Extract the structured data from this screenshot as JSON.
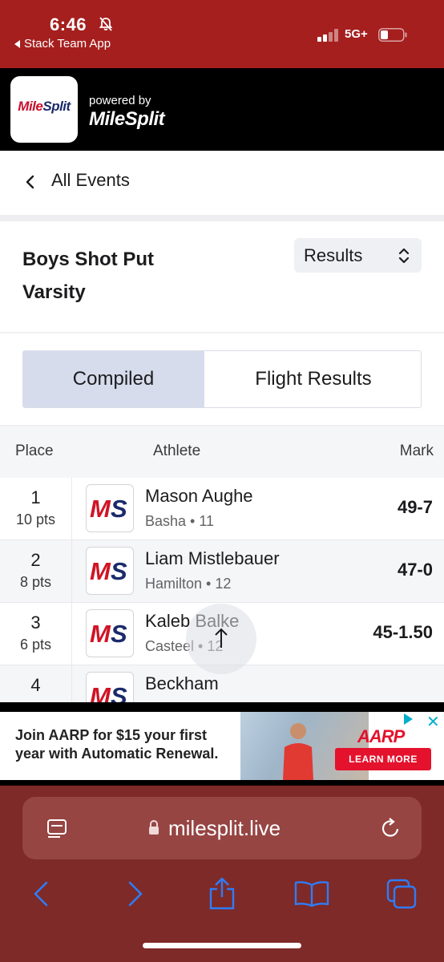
{
  "status_bar": {
    "time": "6:46",
    "back_app": "Stack Team App",
    "network": "5G+",
    "colors": {
      "background": "#a51f1e"
    }
  },
  "header": {
    "logo_text_mile": "Mile",
    "logo_text_split": "Split",
    "powered_by": "powered by",
    "brand": "MileSplit"
  },
  "nav": {
    "back_label": "All Events"
  },
  "event": {
    "title_line1": "Boys Shot Put",
    "title_line2": "Varsity",
    "view_select": "Results"
  },
  "tabs": [
    {
      "label": "Compiled",
      "active": true
    },
    {
      "label": "Flight Results",
      "active": false
    }
  ],
  "table": {
    "columns": {
      "place": "Place",
      "athlete": "Athlete",
      "mark": "Mark"
    },
    "rows": [
      {
        "place": "1",
        "points": "10 pts",
        "name": "Mason Aughe",
        "meta": "Basha • 11",
        "mark": "49-7"
      },
      {
        "place": "2",
        "points": "8 pts",
        "name": "Liam Mistlebauer",
        "meta": "Hamilton • 12",
        "mark": "47-0"
      },
      {
        "place": "3",
        "points": "6 pts",
        "name": "Kaleb Balke",
        "meta": "Casteel • 12",
        "mark": "45-1.50"
      },
      {
        "place": "4",
        "points": "",
        "name": "Beckham",
        "meta": "",
        "mark": ""
      }
    ],
    "badge_m": "M",
    "badge_s": "S"
  },
  "ad": {
    "text": "Join AARP for $15 your first year with Automatic Renewal.",
    "logo": "AARP",
    "cta": "LEARN MORE"
  },
  "browser": {
    "url": "milesplit.live",
    "colors": {
      "toolbar": "#7e2a28",
      "accent": "#2f7cf6"
    }
  }
}
